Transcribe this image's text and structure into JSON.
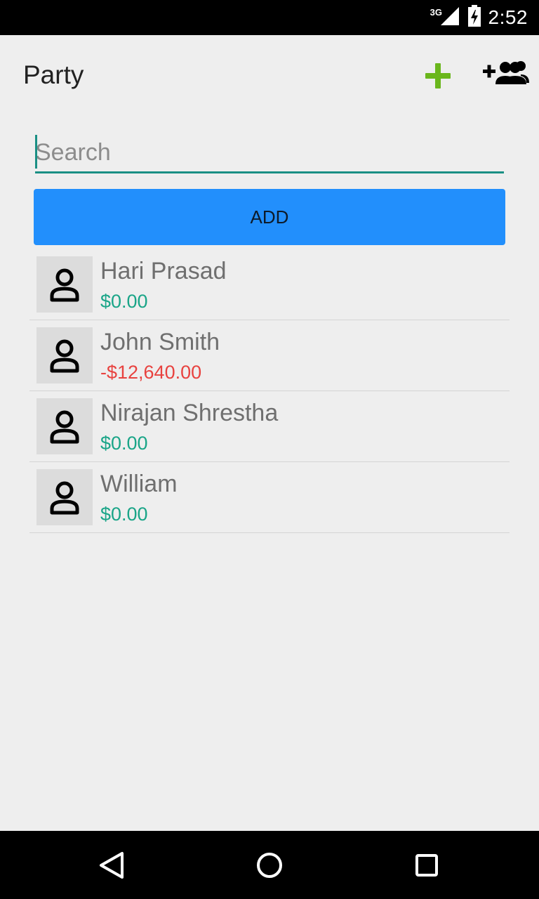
{
  "status_bar": {
    "network": "3G",
    "time": "2:52"
  },
  "app_bar": {
    "title": "Party",
    "add_icon": "plus-icon",
    "add_group_icon": "group-add-icon",
    "add_icon_color": "#6ab61c"
  },
  "search": {
    "placeholder": "Search",
    "value": ""
  },
  "add_button": {
    "label": "ADD",
    "color": "#228ffc"
  },
  "colors": {
    "positive": "#1aa588",
    "negative": "#e8423f",
    "accent": "#1a8f84"
  },
  "parties": [
    {
      "name": "Hari Prasad",
      "balance": "$0.00",
      "status": "positive",
      "icon": "person-icon"
    },
    {
      "name": "John Smith",
      "balance": "-$12,640.00",
      "status": "negative",
      "icon": "person-icon"
    },
    {
      "name": "Nirajan Shrestha",
      "balance": "$0.00",
      "status": "positive",
      "icon": "person-icon"
    },
    {
      "name": "William",
      "balance": "$0.00",
      "status": "positive",
      "icon": "person-icon"
    }
  ],
  "nav_bar": {
    "back_icon": "back-icon",
    "home_icon": "home-icon",
    "recents_icon": "recents-icon"
  }
}
